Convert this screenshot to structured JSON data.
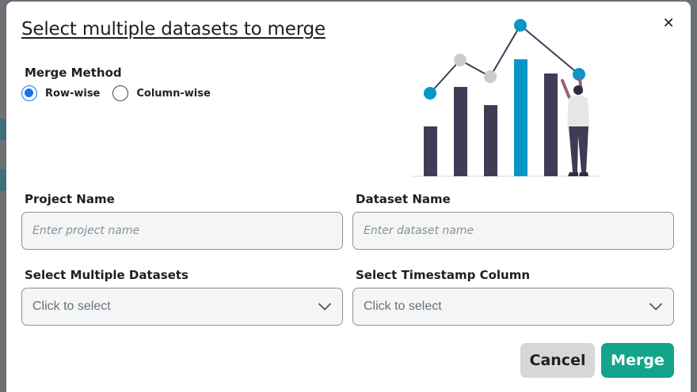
{
  "background": {
    "dots": "..."
  },
  "dialog": {
    "title": "Select multiple datasets to merge",
    "close_icon": "close-icon",
    "merge_method": {
      "label": "Merge Method",
      "options": [
        {
          "label": "Row-wise",
          "selected": true
        },
        {
          "label": "Column-wise",
          "selected": false
        }
      ]
    },
    "project_name": {
      "label": "Project Name",
      "placeholder": "Enter project name",
      "value": ""
    },
    "dataset_name": {
      "label": "Dataset Name",
      "placeholder": "Enter dataset name",
      "value": ""
    },
    "multiple_datasets": {
      "label": "Select Multiple Datasets",
      "value": "Click to select",
      "icon": "chevron-down-icon"
    },
    "timestamp_column": {
      "label": "Select Timestamp Column",
      "value": "Click to select",
      "icon": "chevron-down-icon"
    },
    "buttons": {
      "cancel": "Cancel",
      "merge": "Merge"
    }
  },
  "colors": {
    "accent": "#1a73e8",
    "primary_button": "#12a58a",
    "secondary_button": "#d6d7d8",
    "illustration_teal": "#0797c5",
    "illustration_dark": "#3f3d56"
  }
}
